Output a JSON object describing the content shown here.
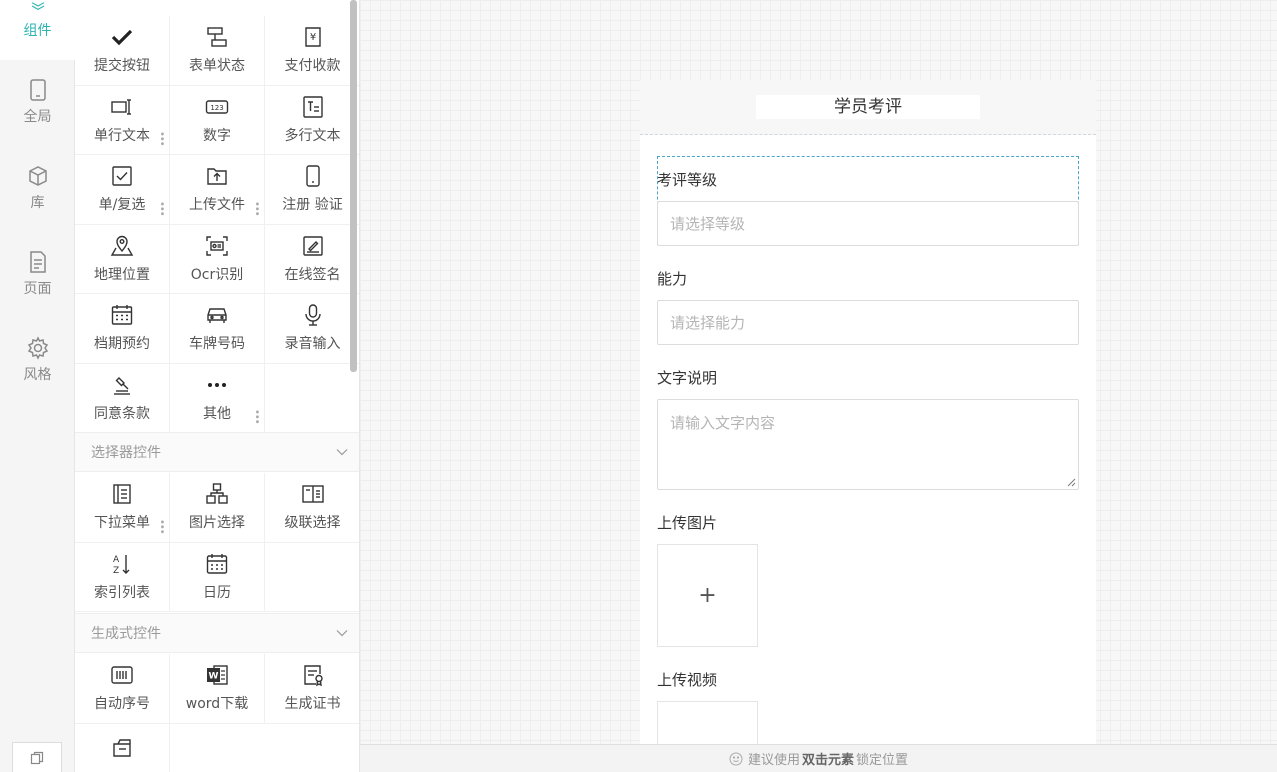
{
  "rail": {
    "items": [
      {
        "label": "组件",
        "icon": "layers-icon"
      },
      {
        "label": "全局",
        "icon": "tablet-icon"
      },
      {
        "label": "库",
        "icon": "box-icon"
      },
      {
        "label": "页面",
        "icon": "page-icon"
      },
      {
        "label": "风格",
        "icon": "gear-icon"
      }
    ],
    "accent": "#2bb4b0"
  },
  "basic_section": {
    "items": [
      {
        "label": "提交按钮",
        "icon": "check-icon"
      },
      {
        "label": "表单状态",
        "icon": "form-status-icon"
      },
      {
        "label": "支付收款",
        "icon": "payment-icon"
      },
      {
        "label": "单行文本",
        "icon": "single-line-text-icon"
      },
      {
        "label": "数字",
        "icon": "number-icon"
      },
      {
        "label": "多行文本",
        "icon": "multi-line-text-icon"
      },
      {
        "label": "单/复选",
        "icon": "checkbox-icon"
      },
      {
        "label": "上传文件",
        "icon": "upload-file-icon"
      },
      {
        "label": "注册 验证",
        "icon": "phone-verify-icon"
      },
      {
        "label": "地理位置",
        "icon": "location-icon"
      },
      {
        "label": "Ocr识别",
        "icon": "ocr-icon"
      },
      {
        "label": "在线签名",
        "icon": "signature-icon"
      },
      {
        "label": "档期预约",
        "icon": "schedule-icon"
      },
      {
        "label": "车牌号码",
        "icon": "car-icon"
      },
      {
        "label": "录音输入",
        "icon": "microphone-icon"
      },
      {
        "label": "同意条款",
        "icon": "gavel-icon"
      },
      {
        "label": "其他",
        "icon": "more-icon"
      }
    ]
  },
  "selector_section": {
    "title": "选择器控件",
    "items": [
      {
        "label": "下拉菜单",
        "icon": "dropdown-list-icon"
      },
      {
        "label": "图片选择",
        "icon": "image-select-icon"
      },
      {
        "label": "级联选择",
        "icon": "cascade-select-icon"
      },
      {
        "label": "索引列表",
        "icon": "sort-az-icon"
      },
      {
        "label": "日历",
        "icon": "calendar-icon"
      }
    ]
  },
  "generator_section": {
    "title": "生成式控件",
    "items": [
      {
        "label": "自动序号",
        "icon": "barcode-icon"
      },
      {
        "label": "word下载",
        "icon": "word-icon"
      },
      {
        "label": "生成证书",
        "icon": "certificate-icon"
      }
    ]
  },
  "form": {
    "title": "学员考评",
    "fields": {
      "grade_label": "考评等级",
      "grade_placeholder": "请选择等级",
      "ability_label": "能力",
      "ability_placeholder": "请选择能力",
      "desc_label": "文字说明",
      "desc_placeholder": "请输入文字内容",
      "image_label": "上传图片",
      "video_label": "上传视频",
      "plus": "+"
    }
  },
  "bottom_bar": {
    "prefix": "建议使用",
    "emphasis": "双击元素",
    "suffix": "锁定位置"
  }
}
